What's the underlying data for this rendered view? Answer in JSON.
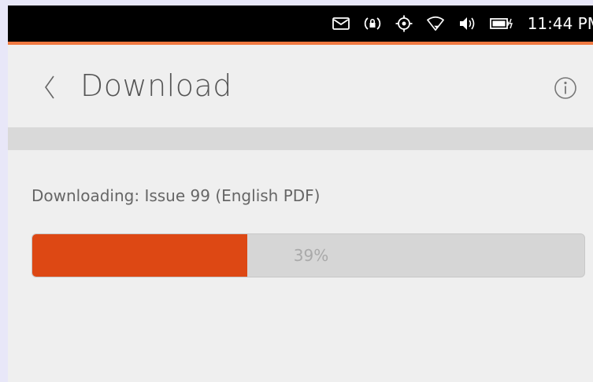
{
  "status_bar": {
    "icons": [
      "mail-icon",
      "location-lock-icon",
      "gps-icon",
      "wifi-icon",
      "volume-icon",
      "battery-charging-icon"
    ],
    "time": "11:44 PM",
    "accent_color": "#f07941"
  },
  "header": {
    "title": "Download",
    "back_icon": "chevron-left-icon",
    "info_icon": "info-icon"
  },
  "download": {
    "status_text": "Downloading: Issue 99 (English PDF)",
    "progress_fraction": 0.39,
    "progress_label": "39%",
    "fill_color": "#dd4814"
  }
}
